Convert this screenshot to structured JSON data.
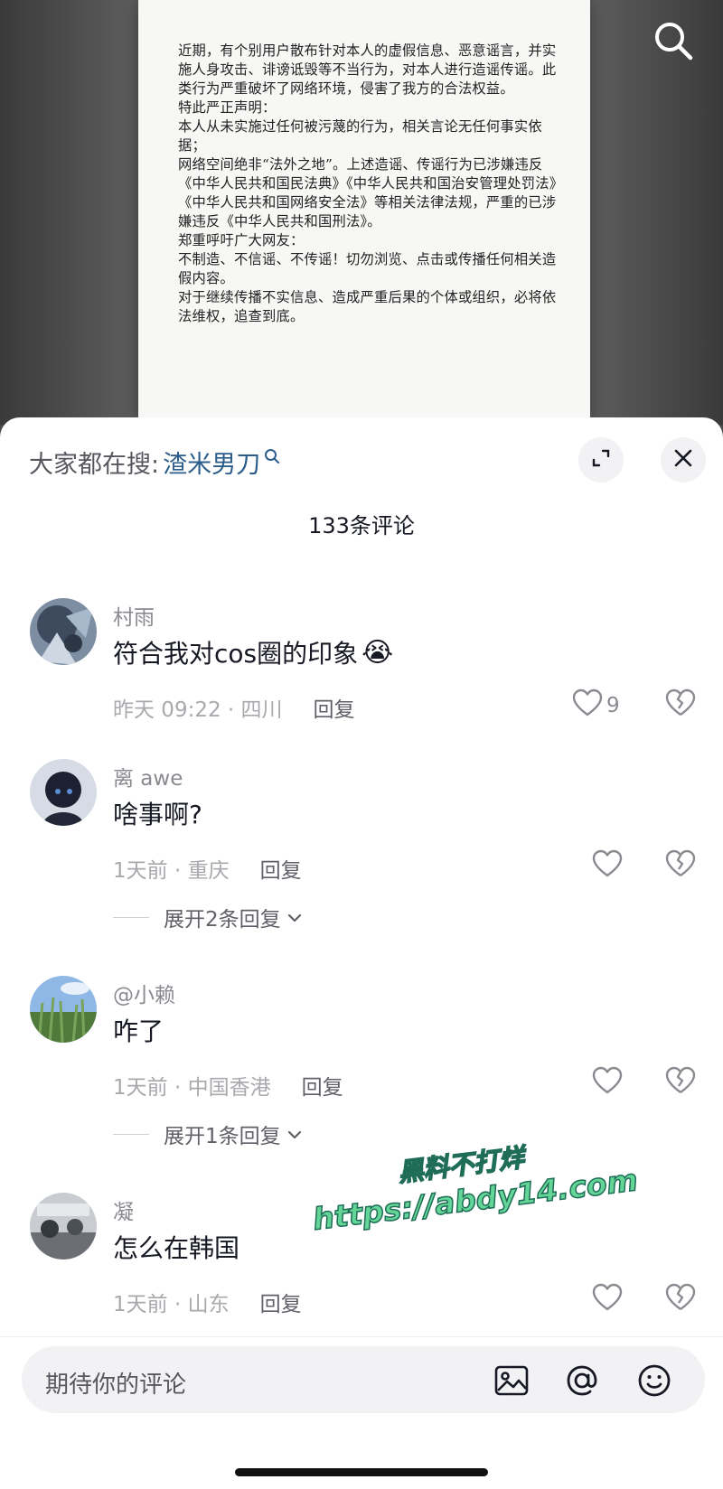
{
  "statement": {
    "paragraphs": [
      "近期，有个别用户散布针对本人的虚假信息、恶意谣言，并实施人身攻击、诽谤诋毁等不当行为，对本人进行造谣传谣。此类行为严重破坏了网络环境，侵害了我方的合法权益。",
      "特此严正声明：",
      "本人从未实施过任何被污蔑的行为，相关言论无任何事实依据；",
      "网络空间绝非“法外之地”。上述造谣、传谣行为已涉嫌违反《中华人民共和国民法典》《中华人民共和国治安管理处罚法》《中华人民共和国网络安全法》等相关法律法规，严重的已涉嫌违反《中华人民共和国刑法》。",
      "郑重呼吁广大网友：",
      "不制造、不信谣、不传谣！切勿浏览、点击或传播任何相关造假内容。",
      "对于继续传播不实信息、造成严重后果的个体或组织，必将依法维权，追查到底。"
    ]
  },
  "sheet": {
    "trend_prefix": "大家都在搜:",
    "trend_keyword": "渣米男刀",
    "comment_count": "133条评论"
  },
  "comments": [
    {
      "user": "村雨",
      "text": "符合我对cos圈的印象",
      "emoji": "😭",
      "time": "昨天 09:22 · 四川",
      "reply": "回复",
      "likes": "9"
    },
    {
      "user": "离 awe",
      "text": "啥事啊?",
      "time": "1天前 · 重庆",
      "reply": "回复",
      "likes": "",
      "expand": "展开2条回复"
    },
    {
      "user": "@小赖",
      "text": "咋了",
      "time": "1天前 · 中国香港",
      "reply": "回复",
      "likes": "",
      "expand": "展开1条回复"
    },
    {
      "user": "凝",
      "text": "怎么在韩国",
      "time": "1天前 · 山东",
      "reply": "回复",
      "likes": ""
    }
  ],
  "watermark": {
    "line1": "黑料不打烊",
    "line2": "https://abdy14.com"
  },
  "input": {
    "placeholder": "期待你的评论"
  },
  "colors": {
    "keyword": "#2b5c8a",
    "muted": "#a8a9ad",
    "watermark": "#63d596"
  },
  "icons": [
    "search-icon",
    "expand-icon",
    "close-icon",
    "heart-icon",
    "broken-heart-icon",
    "chevron-down-icon",
    "image-icon",
    "at-icon",
    "emoji-icon"
  ]
}
